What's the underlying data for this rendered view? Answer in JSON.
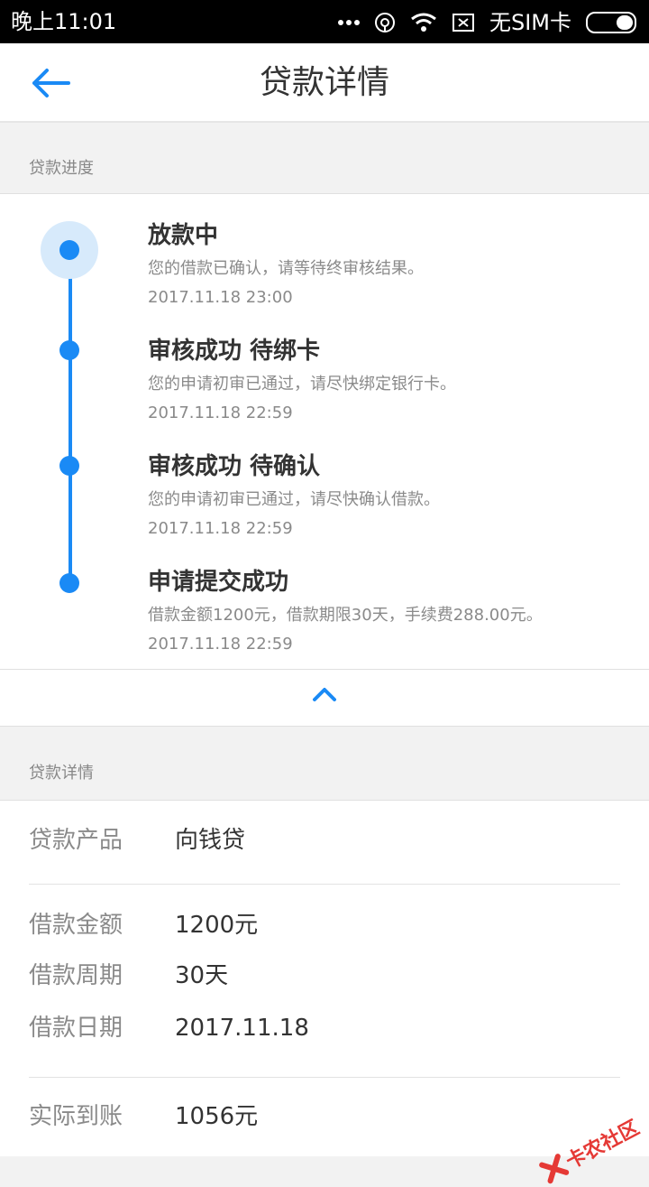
{
  "status_bar": {
    "time": "晚上11:01",
    "carrier": "无SIM卡"
  },
  "header": {
    "title": "贷款详情"
  },
  "progress_section": {
    "heading": "贷款进度",
    "steps": [
      {
        "title": "放款中",
        "desc": "您的借款已确认，请等待终审核结果。",
        "time": "2017.11.18 23:00"
      },
      {
        "title": "审核成功 待绑卡",
        "desc": "您的申请初审已通过，请尽快绑定银行卡。",
        "time": "2017.11.18 22:59"
      },
      {
        "title": "审核成功 待确认",
        "desc": "您的申请初审已通过，请尽快确认借款。",
        "time": "2017.11.18 22:59"
      },
      {
        "title": "申请提交成功",
        "desc": "借款金额1200元，借款期限30天，手续费288.00元。",
        "time": "2017.11.18 22:59"
      }
    ]
  },
  "detail_section": {
    "heading": "贷款详情",
    "rows": [
      {
        "label": "贷款产品",
        "value": "向钱贷"
      },
      {
        "label": "借款金额",
        "value": "1200元"
      },
      {
        "label": "借款周期",
        "value": "30天"
      },
      {
        "label": "借款日期",
        "value": "2017.11.18"
      },
      {
        "label": "实际到账",
        "value": "1056元"
      }
    ]
  },
  "watermark": {
    "text": "卡农社区"
  },
  "colors": {
    "accent": "#1a8af5",
    "halo": "#d7eafb",
    "watermark": "#e53935"
  }
}
